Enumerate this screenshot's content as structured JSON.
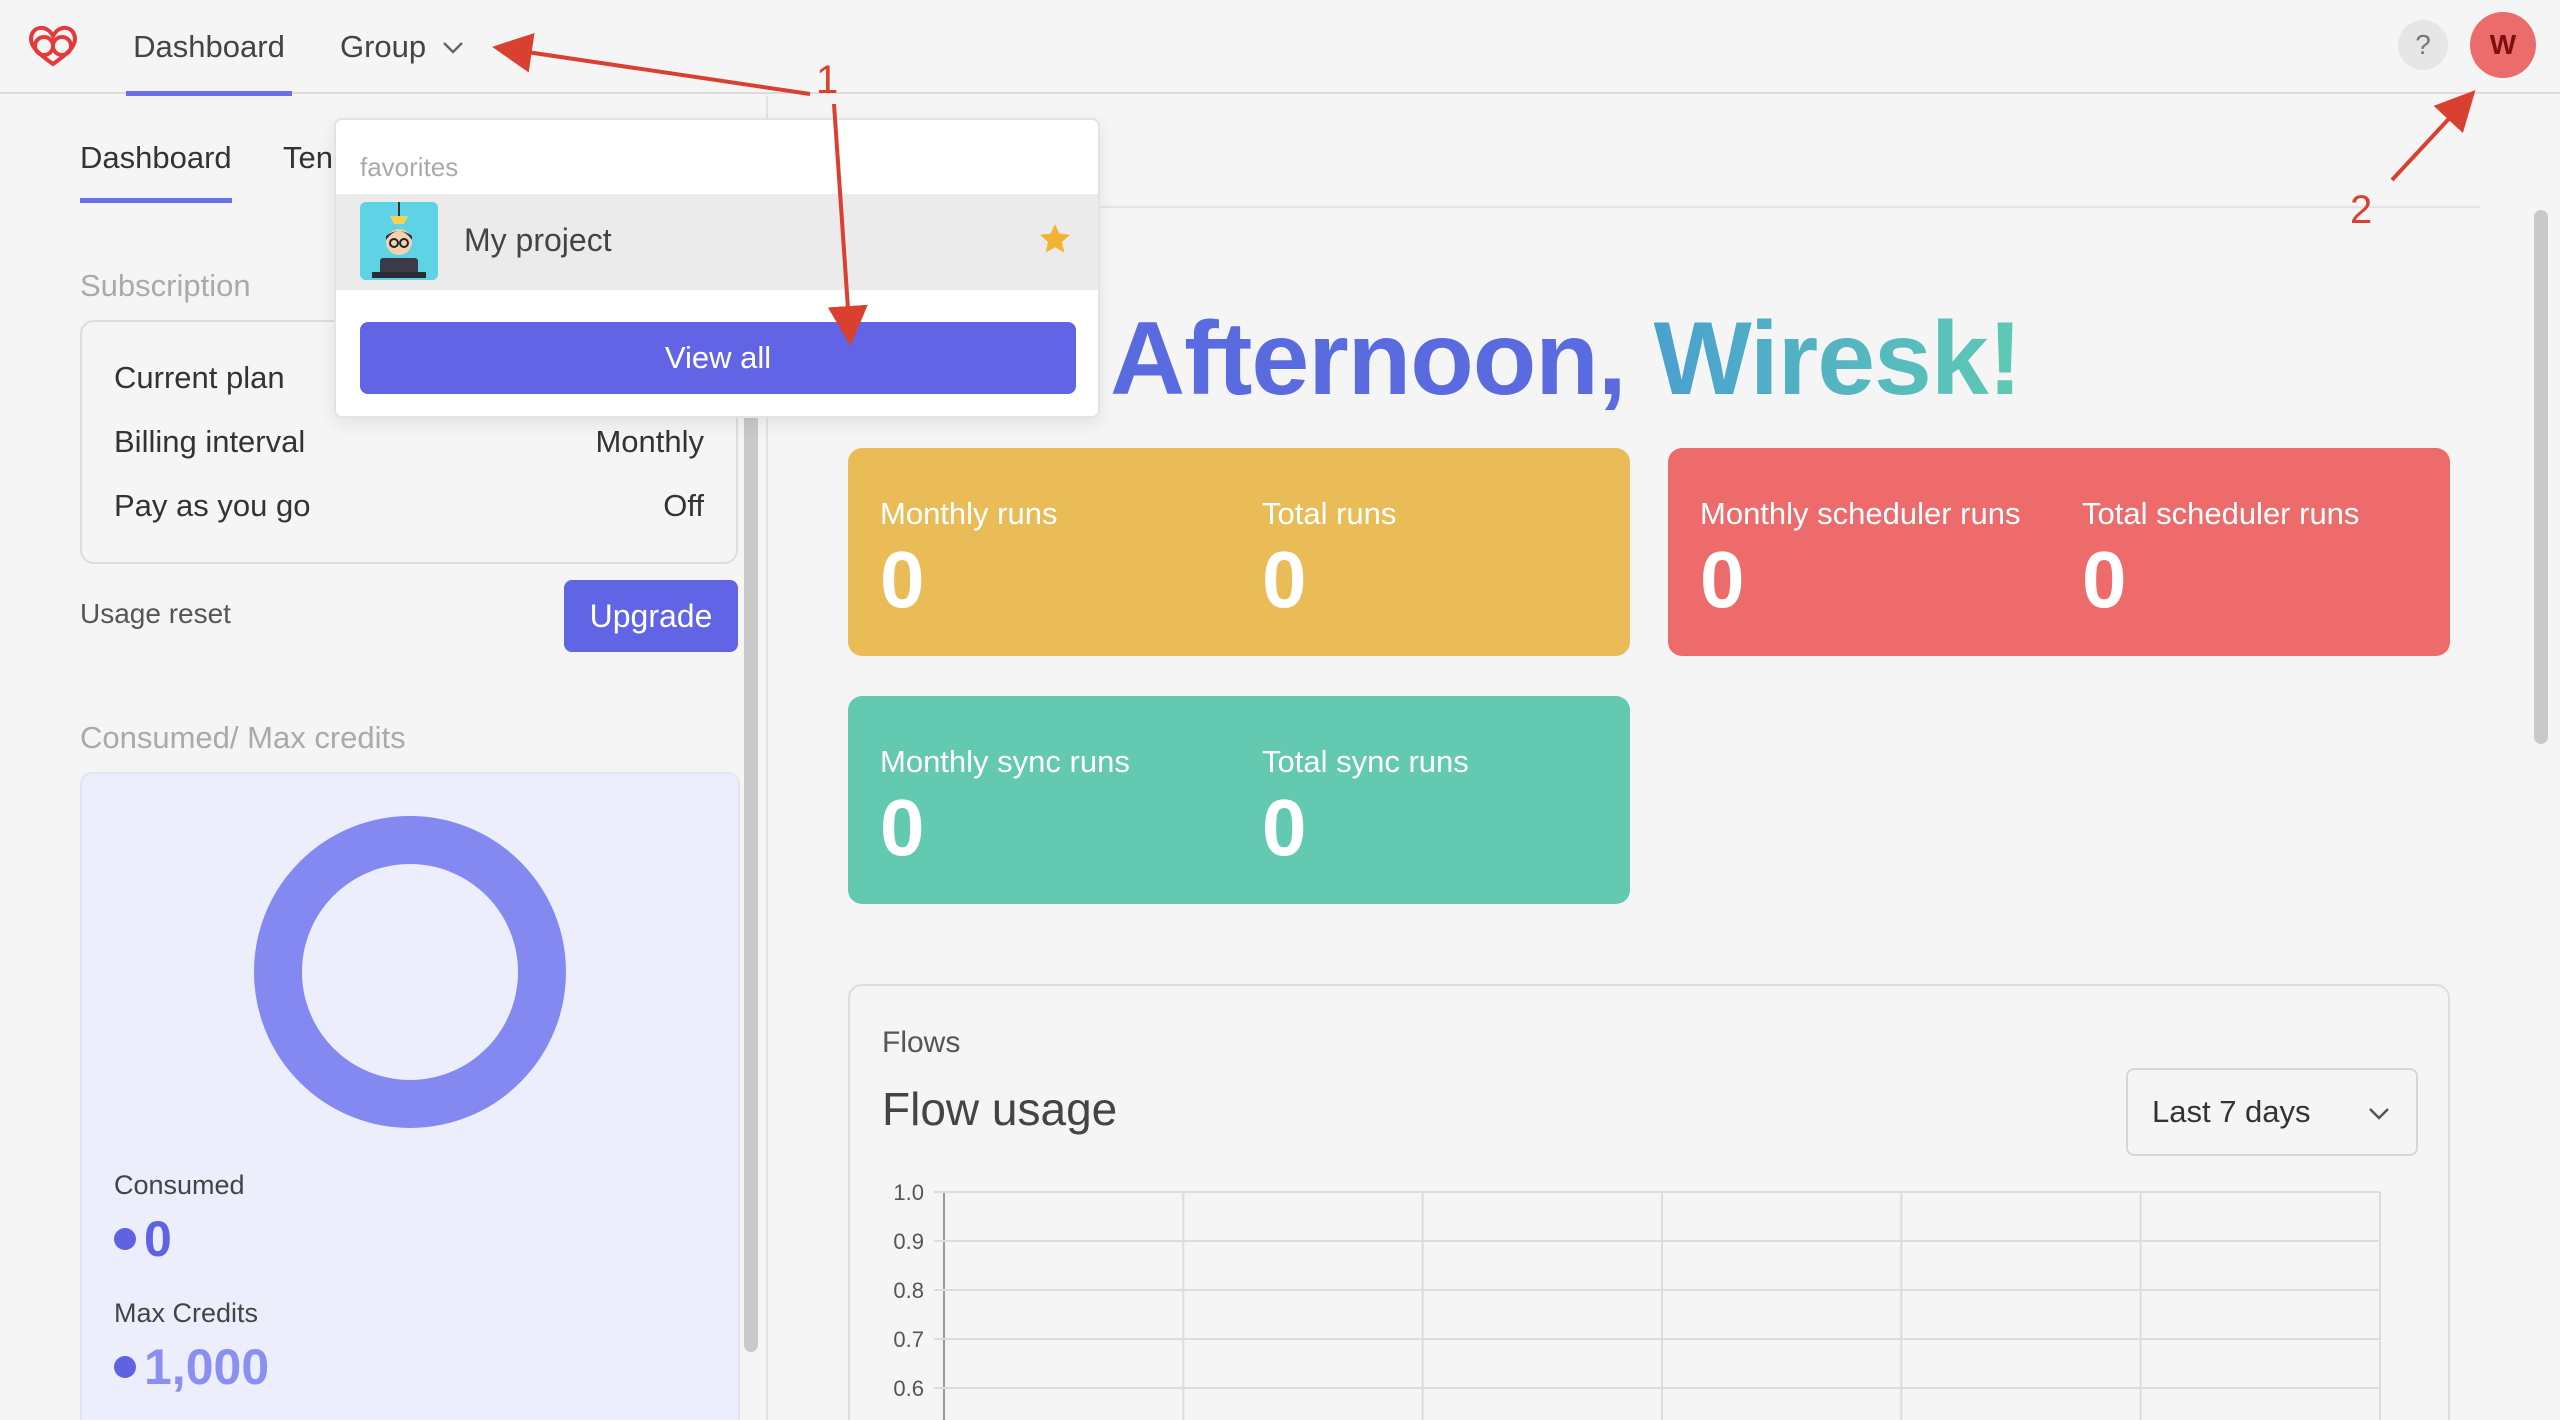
{
  "topbar": {
    "nav": {
      "dashboard": "Dashboard",
      "group": "Group"
    },
    "help": "?",
    "avatar_initial": "W"
  },
  "tabs": {
    "dashboard": "Dashboard",
    "templates": "Ten"
  },
  "subscription": {
    "heading": "Subscription",
    "rows": [
      {
        "label": "Current plan",
        "value": ""
      },
      {
        "label": "Billing interval",
        "value": "Monthly"
      },
      {
        "label": "Pay as you go",
        "value": "Off"
      }
    ],
    "usage_reset": "Usage reset",
    "upgrade": "Upgrade"
  },
  "credits": {
    "heading": "Consumed/ Max credits",
    "consumed_label": "Consumed",
    "consumed_value": "0",
    "max_label": "Max Credits",
    "max_value": "1,000",
    "consumed_fraction": 0
  },
  "dropdown": {
    "section": "favorites",
    "item_label": "My project",
    "view_all": "View all"
  },
  "greeting": {
    "part1": "Afternoon, ",
    "part2": "Wiresk!"
  },
  "stats": {
    "monthly_runs": {
      "label": "Monthly runs",
      "value": "0"
    },
    "total_runs": {
      "label": "Total runs",
      "value": "0"
    },
    "monthly_scheduler_runs": {
      "label": "Monthly scheduler runs",
      "value": "0"
    },
    "total_scheduler_runs": {
      "label": "Total scheduler runs",
      "value": "0"
    },
    "monthly_sync_runs": {
      "label": "Monthly sync runs",
      "value": "0"
    },
    "total_sync_runs": {
      "label": "Total sync runs",
      "value": "0"
    }
  },
  "flows": {
    "eyebrow": "Flows",
    "title": "Flow usage",
    "range": "Last 7 days"
  },
  "chart_data": {
    "type": "line",
    "title": "",
    "xlabel": "",
    "ylabel": "",
    "y_ticks": [
      "1.0",
      "0.9",
      "0.8",
      "0.7",
      "0.6"
    ],
    "ylim_visible": [
      0.6,
      1.0
    ],
    "x_gridlines": 6,
    "grid": true,
    "series": []
  },
  "annotations": {
    "arrow1": "1",
    "arrow2": "2"
  },
  "colors": {
    "accent": "#6264e6",
    "yellow": "#e9bc57",
    "red": "#ee6b6b",
    "teal": "#63c9b0",
    "star": "#f2b233",
    "annotation": "#d9402f"
  },
  "icons": {
    "logo": "brand-logo-icon",
    "group_chevron": "chevron-down-icon",
    "star": "star-icon",
    "range_chevron": "chevron-down-icon"
  }
}
